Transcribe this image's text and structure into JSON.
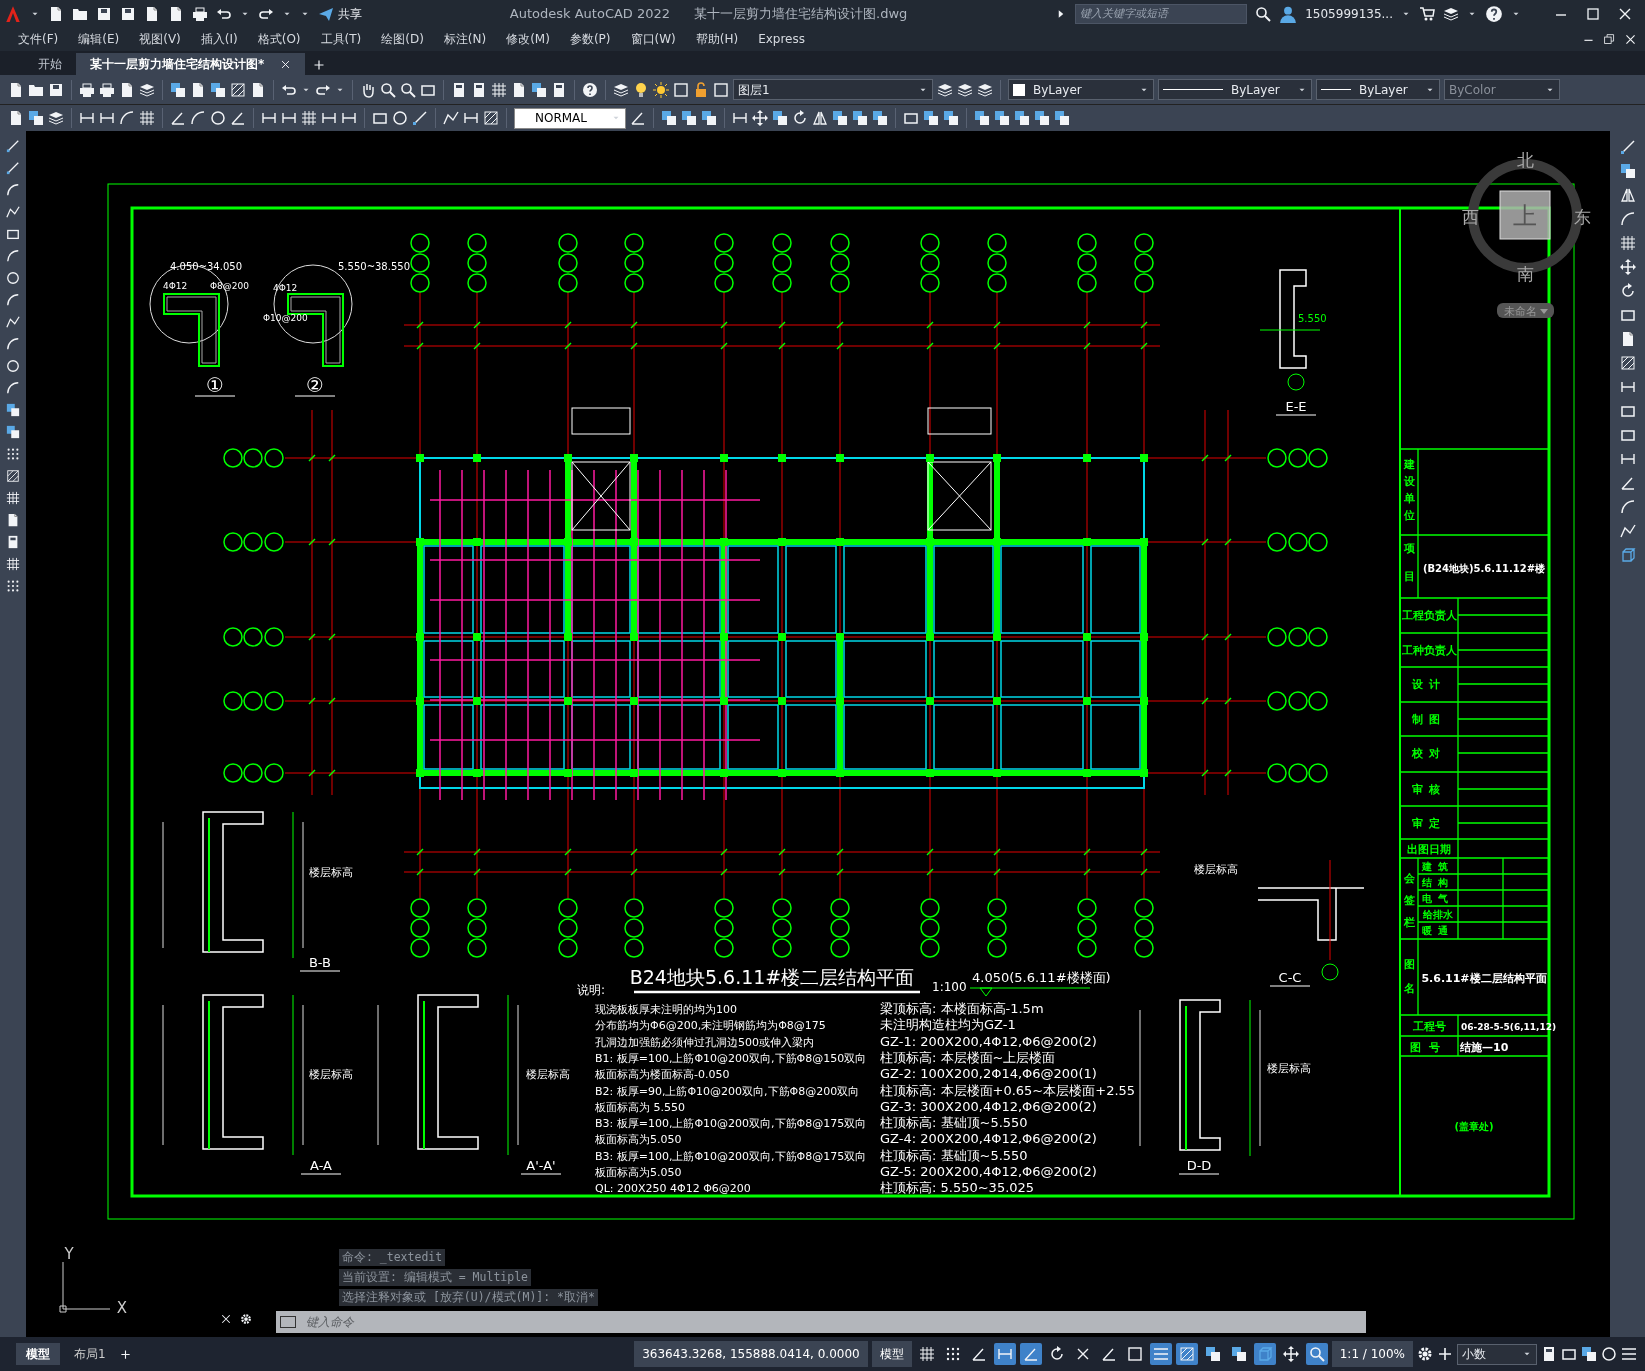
{
  "window": {
    "app": "Autodesk AutoCAD 2022",
    "file": "某十一层剪力墙住宅结构设计图.dwg"
  },
  "quick_access": {
    "share": "共享"
  },
  "search": {
    "placeholder": "键入关键字或短语"
  },
  "user": {
    "name": "1505999135..."
  },
  "menu": [
    "文件(F)",
    "编辑(E)",
    "视图(V)",
    "插入(I)",
    "格式(O)",
    "工具(T)",
    "绘图(D)",
    "标注(N)",
    "修改(M)",
    "参数(P)",
    "窗口(W)",
    "帮助(H)",
    "Express"
  ],
  "doc_tabs": [
    {
      "label": "开始",
      "selected": false
    },
    {
      "label": "某十一层剪力墙住宅结构设计图*",
      "selected": true
    }
  ],
  "properties": {
    "layer": "图层1",
    "color_control": "ByLayer",
    "linetype": "ByLayer",
    "lineweight": "ByLayer",
    "plot_style": "ByColor",
    "text_style": "NORMAL"
  },
  "viewcube": {
    "north": "北",
    "south": "南",
    "west": "西",
    "east": "东",
    "face": "上",
    "ucs": "未命名"
  },
  "drawing": {
    "title": "B24地块5.6.11#楼二层结构平面",
    "scale": "1:100",
    "level": "4.050(5.6.11#楼楼面)",
    "notes_heading": "说明:",
    "notes_left": [
      "现浇板板厚未注明的均为100",
      "分布筋均为Φ6@200,未注明钢筋均为Φ8@175",
      "孔洞边加强筋必须伸过孔洞边500或伸入梁内",
      "B1: 板厚=100,上筋Φ10@200双向,下筋Φ8@150双向",
      "板面标高为楼面标高-0.050",
      "B2: 板厚=90,上筋Φ10@200双向,下筋Φ8@200双向",
      "板面标高为 5.550",
      "B3: 板厚=100,上筋Φ10@200双向,下筋Φ8@175双向",
      "板面标高为5.050",
      "B3: 板厚=100,上筋Φ10@200双向,下筋Φ8@175双向",
      "板面标高为5.050",
      "QL: 200X250 4Φ12 Φ6@200"
    ],
    "notes_right": [
      "梁顶标高: 本楼面标高-1.5m",
      "未注明构造柱均为GZ-1",
      "GZ-1: 200X200,4Φ12,Φ6@200(2)",
      "柱顶标高: 本层楼面~上层楼面",
      "GZ-2: 100X200,2Φ14,Φ6@200(1)",
      "柱顶标高: 本层楼面+0.65~本层楼面+2.55",
      "GZ-3: 300X200,4Φ12,Φ6@200(2)",
      "柱顶标高: 基础顶~5.550",
      "GZ-4: 200X200,4Φ12,Φ6@200(2)",
      "柱顶标高: 基础顶~5.550",
      "GZ-5: 200X200,4Φ12,Φ6@200(2)",
      "柱顶标高: 5.550~35.025"
    ],
    "detail_labels": [
      "①",
      "②",
      "E-E",
      "B-B",
      "A-A",
      "A'-A'",
      "C-C",
      "D-D"
    ],
    "floor_level_labels": [
      "楼层标高",
      "楼层标高",
      "楼层标高",
      "楼层标高",
      "楼层标高"
    ],
    "detail_texts": [
      "4.050~34.050",
      "5.550~38.550",
      "4Φ12",
      "Φ8@200",
      "4Φ12",
      "Φ10@200",
      "5.550"
    ]
  },
  "title_block": {
    "unit_label": "建设单位",
    "project_label": "项目",
    "project": "(B24地块)5.6.11.12#楼",
    "signoffs": [
      "工程负责人",
      "工种负责人",
      "设计",
      "制图",
      "校对",
      "审核",
      "审定"
    ],
    "date_label": "出图日期",
    "countersign_label": "会签栏",
    "countersign": [
      "建筑",
      "结构",
      "电气",
      "给排水",
      "暖通"
    ],
    "drawing_name_label": "图名",
    "drawing_name": "5.6.11#楼二层结构平面",
    "project_no_label": "工程号",
    "project_no": "06-28-5-5(6,11,12)",
    "sheet_no_label": "图号",
    "sheet_no": "结施—10",
    "stamp": "(盖章处)"
  },
  "ucs": {
    "x": "X",
    "y": "Y"
  },
  "command": {
    "history": [
      "命令: _textedit",
      "当前设置: 编辑模式 = Multiple",
      "选择注释对象或 [放弃(U)/模式(M)]: *取消*"
    ],
    "placeholder": "键入命令"
  },
  "layout_tabs": [
    {
      "label": "模型",
      "selected": true
    },
    {
      "label": "布局1",
      "selected": false
    }
  ],
  "status": {
    "coordinates": "363643.3268, 155888.0414, 0.0000",
    "space": "模型",
    "annotation_scale": "1:1 / 100%",
    "units": "小数",
    "toggles": [
      {
        "on": false
      },
      {
        "on": false
      },
      {
        "on": false
      },
      {
        "on": true
      },
      {
        "on": true
      },
      {
        "on": false
      },
      {
        "on": false
      },
      {
        "on": false
      },
      {
        "on": false
      },
      {
        "on": true
      },
      {
        "on": true
      },
      {
        "on": false
      },
      {
        "on": false
      },
      {
        "on": true
      },
      {
        "on": false
      },
      {
        "on": true
      }
    ]
  }
}
